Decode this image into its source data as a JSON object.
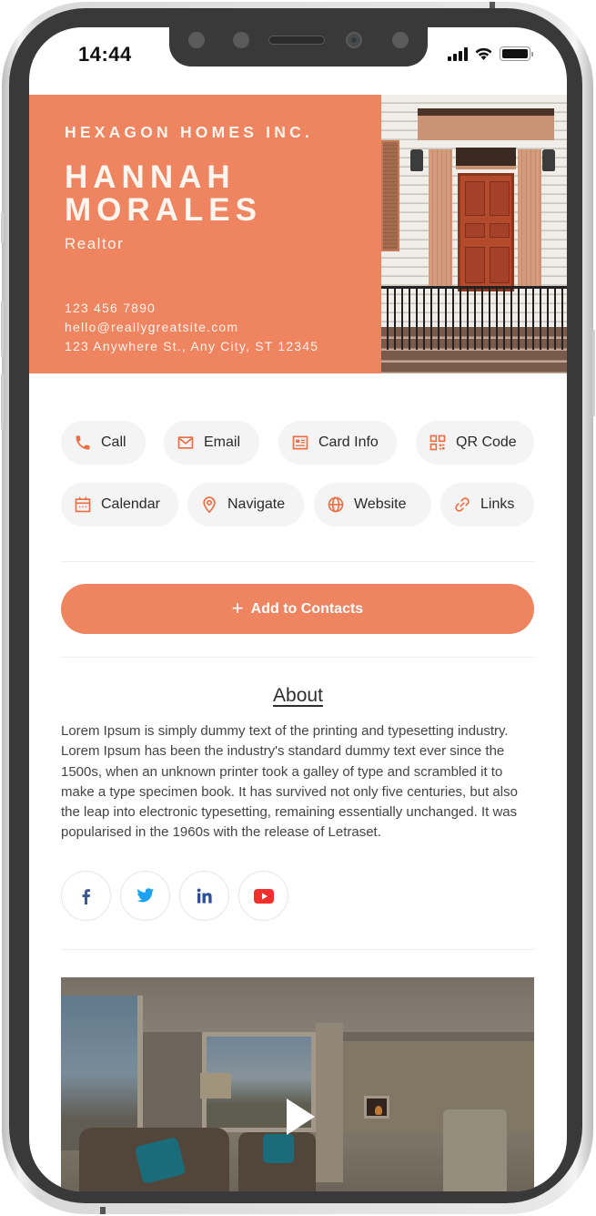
{
  "status_bar": {
    "time": "14:44",
    "icons": [
      "cellular-signal-icon",
      "wifi-icon",
      "battery-icon"
    ]
  },
  "profile": {
    "company": "HEXAGON HOMES INC.",
    "name_line1": "HANNAH",
    "name_line2": "MORALES",
    "role": "Realtor",
    "phone": "123 456 7890",
    "email": "hello@reallygreatsite.com",
    "address": "123 Anywhere St., Any City, ST 12345",
    "hero_image": "front-door-photo"
  },
  "actions": [
    {
      "label": "Call",
      "icon": "phone-icon"
    },
    {
      "label": "Email",
      "icon": "envelope-icon"
    },
    {
      "label": "Card Info",
      "icon": "id-card-icon"
    },
    {
      "label": "QR Code",
      "icon": "qr-code-icon"
    },
    {
      "label": "Calendar",
      "icon": "calendar-icon"
    },
    {
      "label": "Navigate",
      "icon": "map-pin-icon"
    },
    {
      "label": "Website",
      "icon": "globe-icon"
    },
    {
      "label": "Links",
      "icon": "link-icon"
    }
  ],
  "add_contacts": {
    "label": "Add to Contacts",
    "icon": "plus-icon"
  },
  "about": {
    "title": "About",
    "text": "Lorem Ipsum is simply dummy text of the printing and typesetting industry. Lorem Ipsum has been the industry's standard dummy text ever since the 1500s, when an unknown printer took a galley of type and scrambled it to make a type specimen book. It has survived not only five centuries, but also the leap into electronic typesetting, remaining essentially unchanged. It was popularised in the 1960s with the release of Letraset."
  },
  "socials": [
    {
      "name": "facebook",
      "icon": "facebook-icon",
      "color": "#3b5998"
    },
    {
      "name": "twitter",
      "icon": "twitter-icon",
      "color": "#1da1f2"
    },
    {
      "name": "linkedin",
      "icon": "linkedin-icon",
      "color": "#2e4fa0"
    },
    {
      "name": "youtube",
      "icon": "youtube-icon",
      "color": "#f0302c"
    }
  ],
  "video": {
    "thumbnail": "living-room-interior-photo",
    "icon": "play-icon"
  },
  "colors": {
    "accent": "#ee8460",
    "chip_bg": "#f4f4f4",
    "text_dark": "#2a2a2a",
    "bezel": "#393939"
  }
}
